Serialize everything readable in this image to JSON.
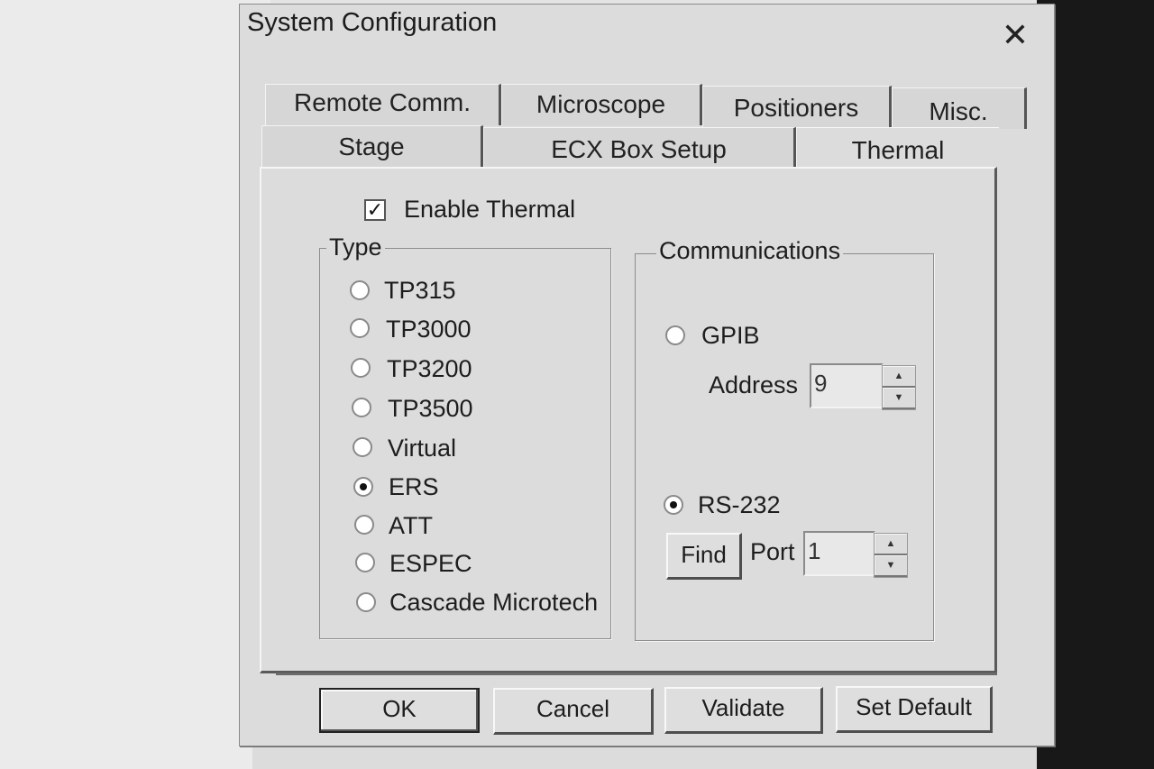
{
  "dialog": {
    "title": "System Configuration",
    "close_glyph": "✕"
  },
  "tabs": {
    "row1": [
      "Remote Comm.",
      "Microscope",
      "Positioners",
      "Misc."
    ],
    "row2": [
      "Stage",
      "ECX Box Setup",
      "Thermal"
    ],
    "active": "Thermal"
  },
  "thermal": {
    "enable_label": "Enable Thermal",
    "enable_checked": true,
    "type_group_title": "Type",
    "types": [
      {
        "label": "TP315",
        "selected": false
      },
      {
        "label": "TP3000",
        "selected": false
      },
      {
        "label": "TP3200",
        "selected": false
      },
      {
        "label": "TP3500",
        "selected": false
      },
      {
        "label": "Virtual",
        "selected": false
      },
      {
        "label": "ERS",
        "selected": true
      },
      {
        "label": "ATT",
        "selected": false
      },
      {
        "label": "ESPEC",
        "selected": false
      },
      {
        "label": "Cascade Microtech",
        "selected": false
      }
    ],
    "comm_group_title": "Communications",
    "gpib": {
      "label": "GPIB",
      "selected": false,
      "address_label": "Address",
      "address_value": "9"
    },
    "rs232": {
      "label": "RS-232",
      "selected": true,
      "find_label": "Find",
      "port_label": "Port",
      "port_value": "1"
    }
  },
  "buttons": {
    "ok": "OK",
    "cancel": "Cancel",
    "validate": "Validate",
    "set_default": "Set Default"
  },
  "icons": {
    "check_glyph": "✓",
    "spin_up": "▲",
    "spin_down": "▼"
  }
}
